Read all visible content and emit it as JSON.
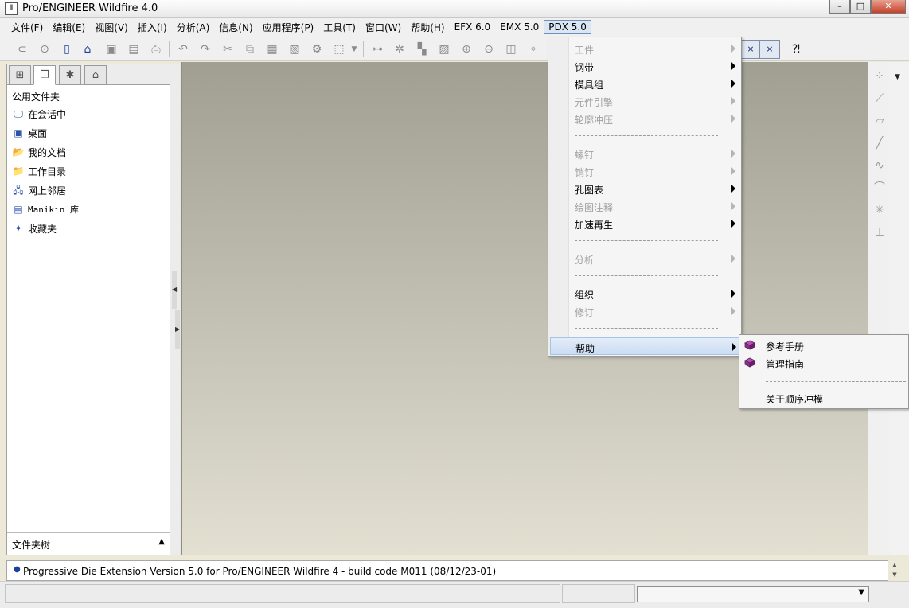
{
  "window": {
    "title": "Pro/ENGINEER Wildfire 4.0",
    "app_icon": "Ⅱ"
  },
  "menubar": [
    {
      "label": "文件(F)"
    },
    {
      "label": "编辑(E)"
    },
    {
      "label": "视图(V)"
    },
    {
      "label": "插入(I)"
    },
    {
      "label": "分析(A)"
    },
    {
      "label": "信息(N)"
    },
    {
      "label": "应用程序(P)"
    },
    {
      "label": "工具(T)"
    },
    {
      "label": "窗口(W)"
    },
    {
      "label": "帮助(H)"
    },
    {
      "label": "EFX 6.0"
    },
    {
      "label": "EMX 5.0"
    },
    {
      "label": "PDX 5.0",
      "active": true
    }
  ],
  "left_panel": {
    "header": "公用文件夹",
    "items": [
      {
        "label": "在会话中",
        "icon": "session-monitor-icon"
      },
      {
        "label": "桌面",
        "icon": "desktop-icon"
      },
      {
        "label": "我的文档",
        "icon": "my-documents-folder-icon"
      },
      {
        "label": "工作目录",
        "icon": "working-directory-folder-icon"
      },
      {
        "label": "网上邻居",
        "icon": "network-neighborhood-icon"
      },
      {
        "label": "Manikin 库",
        "icon": "manikin-library-icon"
      },
      {
        "label": "收藏夹",
        "icon": "favorites-icon"
      }
    ],
    "footer": "文件夹树"
  },
  "pdx_menu": [
    {
      "label": "工件",
      "enabled": false,
      "submenu": true
    },
    {
      "label": "钢带",
      "enabled": true,
      "submenu": true
    },
    {
      "label": "模具组",
      "enabled": true,
      "submenu": true
    },
    {
      "label": "元件引擎",
      "enabled": false,
      "submenu": true
    },
    {
      "label": "轮廓冲压",
      "enabled": false,
      "submenu": true
    },
    {
      "separator": true
    },
    {
      "label": "螺钉",
      "enabled": false,
      "submenu": true
    },
    {
      "label": "销钉",
      "enabled": false,
      "submenu": true
    },
    {
      "label": "孔图表",
      "enabled": true,
      "submenu": true
    },
    {
      "label": "绘图注释",
      "enabled": false,
      "submenu": true
    },
    {
      "label": "加速再生",
      "enabled": true,
      "submenu": true
    },
    {
      "separator": true
    },
    {
      "label": "分析",
      "enabled": false,
      "submenu": true
    },
    {
      "separator": true
    },
    {
      "label": "组织",
      "enabled": true,
      "submenu": true
    },
    {
      "label": "修订",
      "enabled": false,
      "submenu": true
    },
    {
      "separator": true
    },
    {
      "label": "帮助",
      "enabled": true,
      "submenu": true,
      "highlighted": true
    }
  ],
  "help_submenu": [
    {
      "label": "参考手册",
      "icon": "book-icon"
    },
    {
      "label": "管理指南",
      "icon": "book-icon"
    },
    {
      "separator": true
    },
    {
      "label": "关于顺序冲模"
    }
  ],
  "message_area": {
    "text": "Progressive Die Extension Version 5.0 for Pro/ENGINEER Wildfire 4 - build code M011 (08/12/23-01)"
  },
  "colors": {
    "menu_highlight": "#cbdcf2",
    "disabled_text": "#a0a0a0",
    "canvas_top": "#a09f92",
    "canvas_bottom": "#e3e0d2"
  }
}
